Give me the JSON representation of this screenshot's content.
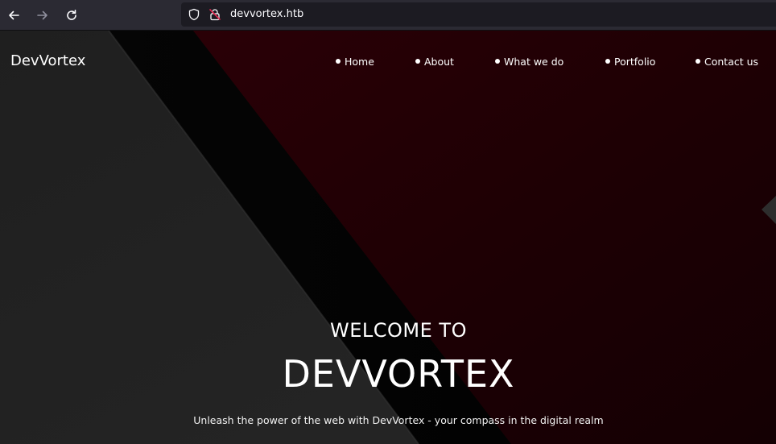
{
  "browser": {
    "url": "devvortex.htb",
    "back_icon": "arrow-left-icon",
    "forward_icon": "arrow-right-icon",
    "reload_icon": "reload-icon",
    "shield_icon": "shield-icon",
    "lock_icon": "insecure-lock-icon"
  },
  "site": {
    "brand": "DevVortex",
    "nav": [
      {
        "label": "Home"
      },
      {
        "label": "About"
      },
      {
        "label": "What we do"
      },
      {
        "label": "Portfolio"
      },
      {
        "label": "Contact us"
      }
    ],
    "hero": {
      "welcome": "WELCOME TO",
      "title": "DEVVORTEX",
      "tagline": "Unleash the power of the web with DevVortex - your compass in the digital realm"
    }
  },
  "colors": {
    "browser_chrome": "#2b2a33",
    "url_field": "#1c1b22",
    "hero_dark": "#1c1c1c",
    "hero_red": "#200004",
    "text": "#ffffff"
  }
}
